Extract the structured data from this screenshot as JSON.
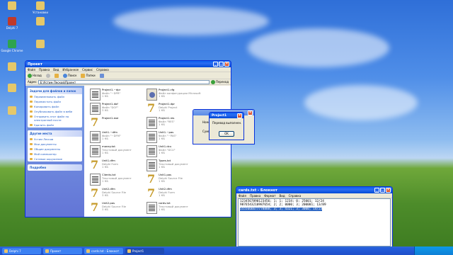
{
  "desktop": {
    "icons": [
      {
        "label": "",
        "icon": "folder-icon"
      },
      {
        "label": "Delphi 7",
        "icon": "delphi-icon"
      },
      {
        "label": "Google Chrome",
        "icon": "chrome-icon"
      },
      {
        "label": "",
        "icon": "folder-icon"
      },
      {
        "label": "",
        "icon": "folder-icon"
      },
      {
        "label": "Установки",
        "icon": "folder-icon"
      },
      {
        "label": "",
        "icon": "folder-icon"
      },
      {
        "label": "",
        "icon": "folder-icon"
      },
      {
        "label": "",
        "icon": "folder-icon"
      },
      {
        "label": "",
        "icon": "folder-icon"
      }
    ]
  },
  "explorer": {
    "title": "Проект",
    "menu": [
      "Файл",
      "Правка",
      "Вид",
      "Избранное",
      "Сервис",
      "Справка"
    ],
    "toolbar": {
      "back": "Назад",
      "search": "Поиск",
      "folders": "Папки"
    },
    "address_label": "Адрес",
    "address_value": "E:\\Устим Лесков\\Проект",
    "go_label": "Переход",
    "tasks": {
      "file_tasks_title": "Задачи для файлов и папок",
      "file_tasks": [
        "Переименовать файл",
        "Переместить файл",
        "Копировать файл",
        "Опубликовать файл в вебе",
        "Отправить этот файл по электронной почте",
        "Удалить файл"
      ],
      "other_places_title": "Другие места",
      "other_places": [
        "Устим Лесков",
        "Мои документы",
        "Общие документы",
        "Мой компьютер",
        "Сетевое окружение"
      ],
      "details_title": "Подробно"
    },
    "files": [
      {
        "name": "Project1.~dpr",
        "type": "Файл \"~DPR\"",
        "size": "1 КБ",
        "icon": "txt"
      },
      {
        "name": "Project1.dof",
        "type": "Файл \"DOF\"",
        "size": "3 КБ",
        "icon": "txt"
      },
      {
        "name": "Project1.exe",
        "type": "",
        "size": "",
        "icon": "delphi"
      },
      {
        "name": "Unit1.~dfm",
        "type": "Файл \"~DFM\"",
        "size": "1 КБ",
        "icon": "txt"
      },
      {
        "name": "money.txt",
        "type": "Текстовый документ",
        "size": "1 КБ",
        "icon": "txt"
      },
      {
        "name": "Unit1.dfm",
        "type": "Delphi Form",
        "size": "1 КБ",
        "icon": "delphi"
      },
      {
        "name": "Clients.txt",
        "type": "Текстовый документ",
        "size": "1 КБ",
        "icon": "txt"
      },
      {
        "name": "Unit2.dfm",
        "type": "Delphi Source File",
        "size": "3 КБ",
        "icon": "delphi"
      },
      {
        "name": "Unit2.pas",
        "type": "Delphi Source File",
        "size": "3 КБ",
        "icon": "delphi"
      },
      {
        "name": "Project1.cfg",
        "type": "Файл конфигурации Microsoft",
        "size": "1 КБ",
        "icon": "cfg"
      },
      {
        "name": "Project1.dpr",
        "type": "Delphi Project",
        "size": "1 КБ",
        "icon": "delphi"
      },
      {
        "name": "Project1.res",
        "type": "Файл \"RES\"",
        "size": "1 КБ",
        "icon": "txt"
      },
      {
        "name": "Unit1.~pas",
        "type": "Файл \"~PAS\"",
        "size": "1 КБ",
        "icon": "txt"
      },
      {
        "name": "Unit1.dcu",
        "type": "Файл \"DCU\"",
        "size": "1 КБ",
        "icon": "txt"
      },
      {
        "name": "Types.txt",
        "type": "Текстовый документ",
        "size": "1 КБ",
        "icon": "txt"
      },
      {
        "name": "Unit1.pas",
        "type": "Delphi Source File",
        "size": "1 КБ",
        "icon": "delphi"
      },
      {
        "name": "Unit2.dfm",
        "type": "Delphi Form",
        "size": "1 КБ",
        "icon": "delphi"
      },
      {
        "name": "cards.txt",
        "type": "Текстовый документ",
        "size": "1 КБ",
        "icon": "txt"
      }
    ]
  },
  "form_bg": {
    "title": "",
    "labels": [
      "Номе",
      "Сумм"
    ]
  },
  "dialog": {
    "title": "Project1",
    "message": "Перевод выполнен.",
    "ok_label": "OK"
  },
  "notepad": {
    "title": "cards.txt - Блокнот",
    "menu": [
      "Файл",
      "Правка",
      "Формат",
      "Вид",
      "Справка"
    ],
    "lines": [
      "1234567890123456; 1; 1; 1234; 0; 25001; 12/24",
      "9876543210987654; 2; 2; 0000; 3; 200001; 13/89",
      "5555666677778888; 3; 3; 4321; 3; 3000; 14/23"
    ]
  },
  "taskbar": {
    "items": [
      "Delphi 7",
      "Проект",
      "cards.txt - Блокнот",
      "Project1"
    ],
    "active_index": 3
  },
  "colors": {
    "xp_blue": "#0a5ff0",
    "task_panel": "#7ba2e7",
    "selection": "#316ac5",
    "close_red": "#d8512b"
  }
}
